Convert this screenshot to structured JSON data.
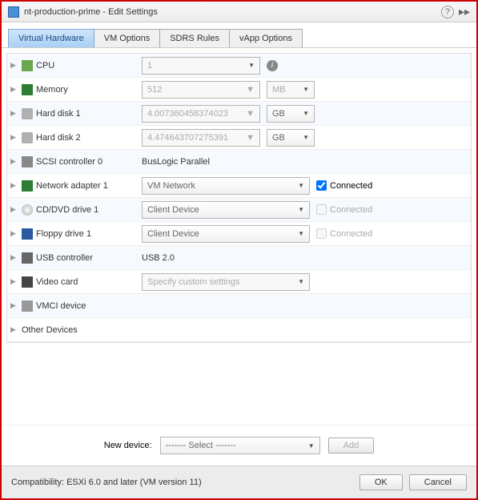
{
  "title": "nt-production-prime - Edit Settings",
  "tabs": [
    "Virtual Hardware",
    "VM Options",
    "SDRS Rules",
    "vApp Options"
  ],
  "rows": {
    "cpu": {
      "label": "CPU",
      "value": "1"
    },
    "memory": {
      "label": "Memory",
      "value": "512",
      "unit": "MB"
    },
    "hd1": {
      "label": "Hard disk 1",
      "value": "4.007360458374023",
      "unit": "GB"
    },
    "hd2": {
      "label": "Hard disk 2",
      "value": "4.474643707275391",
      "unit": "GB"
    },
    "scsi": {
      "label": "SCSI controller 0",
      "value": "BusLogic Parallel"
    },
    "net": {
      "label": "Network adapter 1",
      "value": "VM Network",
      "conn": "Connected"
    },
    "cd": {
      "label": "CD/DVD drive 1",
      "value": "Client Device",
      "conn": "Connected"
    },
    "floppy": {
      "label": "Floppy drive 1",
      "value": "Client Device",
      "conn": "Connected"
    },
    "usb": {
      "label": "USB controller",
      "value": "USB 2.0"
    },
    "video": {
      "label": "Video card",
      "value": "Specify custom settings"
    },
    "vmci": {
      "label": "VMCI device"
    },
    "other": {
      "label": "Other Devices"
    }
  },
  "newdev": {
    "label": "New device:",
    "select": "------- Select -------",
    "add": "Add"
  },
  "footer": {
    "compat": "Compatibility: ESXi 6.0 and later (VM version 11)",
    "ok": "OK",
    "cancel": "Cancel"
  }
}
